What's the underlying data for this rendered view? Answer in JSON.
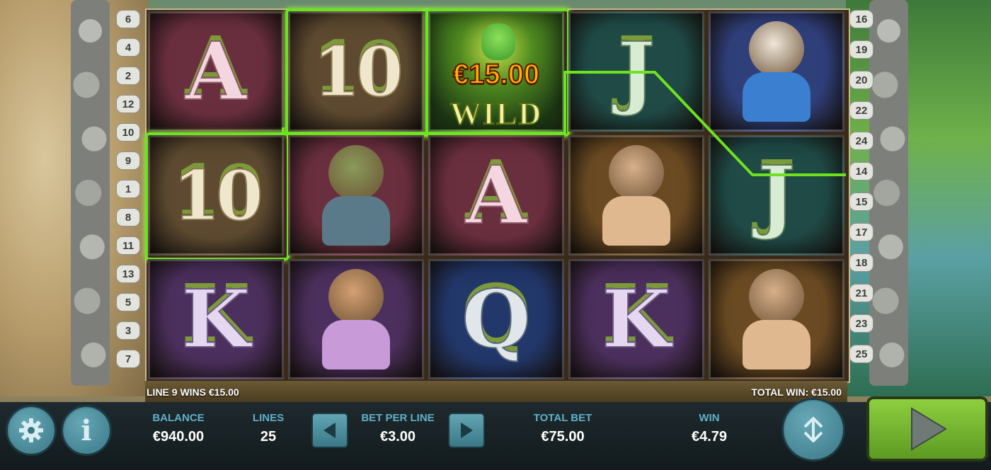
{
  "game": {
    "line_numbers_left": [
      "6",
      "4",
      "2",
      "12",
      "10",
      "9",
      "1",
      "8",
      "11",
      "13",
      "5",
      "3",
      "7"
    ],
    "line_numbers_right": [
      "16",
      "19",
      "20",
      "22",
      "24",
      "14",
      "15",
      "17",
      "18",
      "21",
      "23",
      "25"
    ],
    "reels": [
      [
        {
          "symbol": "A",
          "color": "#6a2f3e",
          "icon": "letter-a-icon"
        },
        {
          "symbol": "10",
          "color": "#5d4a30",
          "icon": "letter-ten-icon",
          "winning": true
        },
        {
          "symbol": "K",
          "color": "#4b2f5c",
          "icon": "letter-k-icon"
        }
      ],
      [
        {
          "symbol": "10",
          "color": "#5d4a30",
          "icon": "letter-ten-icon",
          "winning": true
        },
        {
          "symbol": "Troll",
          "color": "#6a2f3e",
          "icon": "troll-icon"
        },
        {
          "symbol": "Bunny",
          "color": "#4b2f5c",
          "icon": "bunny-icon"
        }
      ],
      [
        {
          "symbol": "WILD",
          "color": "#1f3a16",
          "icon": "frog-wild-icon",
          "winning": true,
          "win_amount": "€15.00"
        },
        {
          "symbol": "A",
          "color": "#6a2f3e",
          "icon": "letter-a-icon"
        },
        {
          "symbol": "Q",
          "color": "#22376a",
          "icon": "letter-q-icon"
        }
      ],
      [
        {
          "symbol": "J",
          "color": "#1f4a46",
          "icon": "letter-j-icon"
        },
        {
          "symbol": "Surfer Goat",
          "color": "#6a4a22",
          "icon": "surfer-goat-icon"
        },
        {
          "symbol": "K",
          "color": "#4b2f5c",
          "icon": "letter-k-icon"
        }
      ],
      [
        {
          "symbol": "Skater Goat",
          "color": "#2f3f7a",
          "icon": "skater-goat-icon"
        },
        {
          "symbol": "J",
          "color": "#1f4a46",
          "icon": "letter-j-icon"
        },
        {
          "symbol": "Surfer Goat",
          "color": "#6a4a22",
          "icon": "surfer-goat-icon"
        }
      ]
    ],
    "line_win_message": "LINE 9 WINS €15.00",
    "total_win_message": "TOTAL WIN: €15.00"
  },
  "panel": {
    "balance_label": "BALANCE",
    "balance_value": "€940.00",
    "lines_label": "LINES",
    "lines_value": "25",
    "bet_per_line_label": "BET PER LINE",
    "bet_per_line_value": "€3.00",
    "total_bet_label": "TOTAL BET",
    "total_bet_value": "€75.00",
    "win_label": "WIN",
    "win_value": "€4.79"
  },
  "colors": {
    "accent": "#5fb0c8",
    "win_line": "#6ee21f",
    "spin": "#7cbf33"
  }
}
